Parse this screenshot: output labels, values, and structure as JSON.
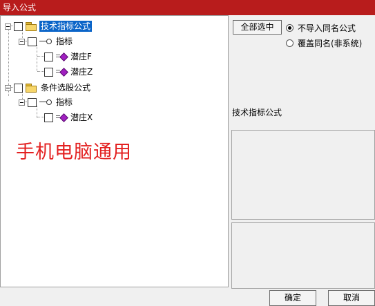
{
  "window": {
    "title": "导入公式"
  },
  "tree": {
    "nodes": [
      {
        "label": "技术指标公式",
        "icon": "folder-icon",
        "selected": true
      },
      {
        "label": "指标",
        "icon": "key-icon"
      },
      {
        "label": "潜庄F",
        "icon": "formula-icon"
      },
      {
        "label": "潜庄Z",
        "icon": "formula-icon"
      },
      {
        "label": "条件选股公式",
        "icon": "folder-icon"
      },
      {
        "label": "指标",
        "icon": "key-icon"
      },
      {
        "label": "潜庄X",
        "icon": "formula-icon"
      }
    ]
  },
  "watermark": "手机电脑通用",
  "options": {
    "select_all_label": "全部选中",
    "radio_no_import_label": "不导入同名公式",
    "radio_overwrite_label": "覆盖同名(非系统)",
    "selected_radio": "不导入同名公式"
  },
  "info": {
    "category_label": "技术指标公式"
  },
  "footer": {
    "ok_label": "确定",
    "cancel_label": "取消"
  },
  "colors": {
    "titlebar": "#b81c1c",
    "selection": "#0a64c8",
    "watermark": "#e32020",
    "formula_icon": "#a020c0"
  }
}
